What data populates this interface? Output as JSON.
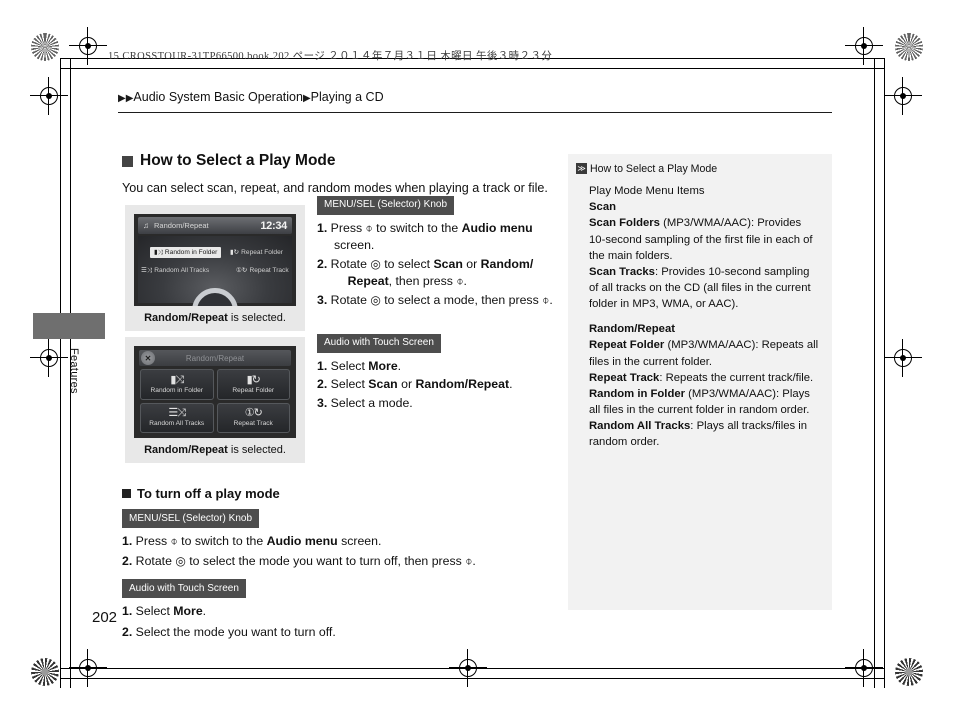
{
  "print": {
    "book_line": "15 CROSSTOUR-31TP66500.book   202 ページ   ２０１４年７月３１日   木曜日   午後３時２３分",
    "page_number": "202",
    "side_tab_label": "Features"
  },
  "breadcrumb": {
    "arrow1": "▶",
    "arrow2": "▶",
    "level1": "Audio System Basic Operation",
    "arrow3": "▶",
    "level2": "Playing a CD"
  },
  "main": {
    "heading": "How to Select a Play Mode",
    "intro": "You can select scan, repeat, and random modes when playing a track or file."
  },
  "knob_section": {
    "tag": "MENU/SEL (Selector) Knob",
    "steps": [
      {
        "n": "1.",
        "parts": [
          "Press ",
          "⌽",
          " to switch to the ",
          "Audio menu",
          " screen."
        ]
      },
      {
        "n": "2.",
        "parts": [
          "Rotate ",
          "◎",
          " to select ",
          "Scan",
          " or ",
          "Random/Repeat",
          ", then press ",
          "⌽",
          "."
        ]
      },
      {
        "n": "3.",
        "parts": [
          "Rotate ",
          "◎",
          " to select a mode, then press ",
          "⌽",
          "."
        ]
      }
    ]
  },
  "touch_section": {
    "tag": "Audio with Touch Screen",
    "steps": [
      {
        "n": "1.",
        "text_pre": "Select ",
        "bold": "More",
        "text_post": "."
      },
      {
        "n": "2.",
        "text_pre": "Select ",
        "bold": "Scan",
        "mid": " or ",
        "bold2": "Random/Repeat",
        "text_post": "."
      },
      {
        "n": "3.",
        "text_pre": "Select a mode.",
        "bold": "",
        "text_post": ""
      }
    ]
  },
  "screenshot_knob": {
    "caption_bold": "Random/Repeat",
    "caption_rest": " is selected.",
    "status_title": "Random/Repeat",
    "clock": "12:34",
    "note_icon": "♫",
    "options": [
      {
        "label": "Random in Folder",
        "icon": "▮⤨",
        "selected": true
      },
      {
        "label": "Repeat Folder",
        "icon": "▮↻",
        "selected": false
      },
      {
        "label": "Random All Tracks",
        "icon": "☰⤨",
        "selected": false
      },
      {
        "label": "Repeat Track",
        "icon": "①↻",
        "selected": false
      }
    ]
  },
  "screenshot_touch": {
    "caption_bold": "Random/Repeat",
    "caption_rest": " is selected.",
    "header_title": "Random/Repeat",
    "close_icon": "✕",
    "buttons": [
      {
        "label": "Random in Folder",
        "icon": "▮⤨"
      },
      {
        "label": "Repeat Folder",
        "icon": "▮↻"
      },
      {
        "label": "Random All Tracks",
        "icon": "☰⤨"
      },
      {
        "label": "Repeat Track",
        "icon": "①↻"
      }
    ]
  },
  "turn_off": {
    "heading": "To turn off a play mode",
    "knob_tag": "MENU/SEL (Selector) Knob",
    "knob_steps": [
      {
        "n": "1.",
        "a": "Press ",
        "g": "⌽",
        "b": " to switch to the ",
        "bold": "Audio menu",
        "c": " screen."
      },
      {
        "n": "2.",
        "a": "Rotate ",
        "g": "◎",
        "b": " to select the mode you want to turn off, then press ",
        "bold": "",
        "c": " ⌽ ."
      }
    ],
    "touch_tag": "Audio with Touch Screen",
    "touch_steps": [
      {
        "n": "1.",
        "a": "Select ",
        "bold": "More",
        "c": "."
      },
      {
        "n": "2.",
        "a": "Select the mode you want to turn off.",
        "bold": "",
        "c": ""
      }
    ]
  },
  "side_panel": {
    "marker": "≫",
    "title": "How to Select a Play Mode",
    "subtitle": "Play Mode Menu Items",
    "group1_heading": "Scan",
    "scan_folders_bold": "Scan Folders",
    "scan_folders_text": " (MP3/WMA/AAC): Provides 10-second sampling of the first file in each of the main folders.",
    "scan_tracks_bold": "Scan Tracks",
    "scan_tracks_text": ": Provides 10-second sampling of all tracks on the CD (all files in the current folder in MP3, WMA, or AAC).",
    "group2_heading": "Random/Repeat",
    "repeat_folder_bold": "Repeat Folder",
    "repeat_folder_text": " (MP3/WMA/AAC): Repeats all files in the current folder.",
    "repeat_track_bold": "Repeat Track",
    "repeat_track_text": ": Repeats the current track/file.",
    "random_folder_bold": "Random in Folder",
    "random_folder_text": " (MP3/WMA/AAC): Plays all files in the current folder in random order.",
    "random_all_bold": "Random All Tracks",
    "random_all_text": ": Plays all tracks/files in random order."
  },
  "colors": {
    "panel_bg": "#f2f2f2",
    "tag_bg": "#4d4d4d",
    "shot_frame": "#e8e8e8",
    "side_tab": "#6f6f6f"
  }
}
